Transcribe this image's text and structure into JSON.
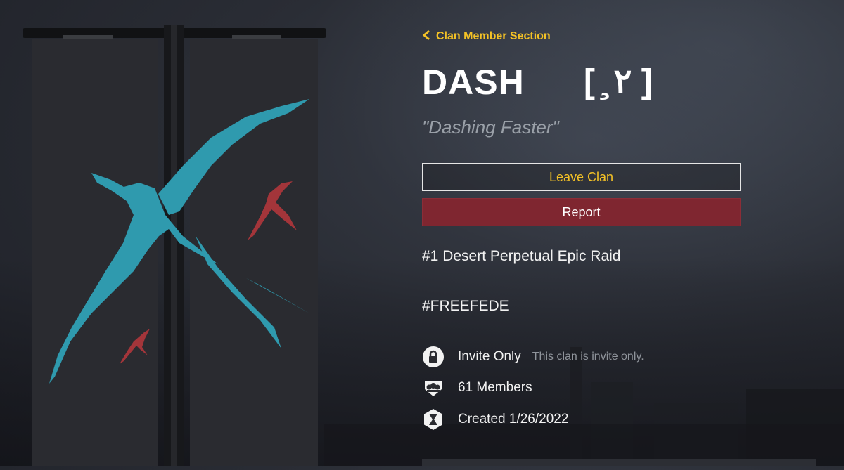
{
  "nav": {
    "back_label": "Clan Member Section"
  },
  "clan": {
    "name": "DASH",
    "tag": "[ ̧ ٢ ]",
    "motto": "\"Dashing Faster\""
  },
  "actions": {
    "leave_label": "Leave Clan",
    "report_label": "Report"
  },
  "about": {
    "line1": "#1 Desert Perpetual Epic Raid",
    "line2": "#FREEFEDE"
  },
  "info": {
    "privacy": {
      "label": "Invite Only",
      "detail": "This clan is invite only.",
      "icon": "lock-icon"
    },
    "members": {
      "label": "61 Members",
      "icon": "members-icon"
    },
    "created": {
      "label": "Created 1/26/2022",
      "icon": "hourglass-icon"
    }
  },
  "colors": {
    "accent": "#f3c126",
    "report": "#7f2630",
    "banner_bird": "#2f9aae",
    "banner_small_birds": "#a3353a"
  }
}
